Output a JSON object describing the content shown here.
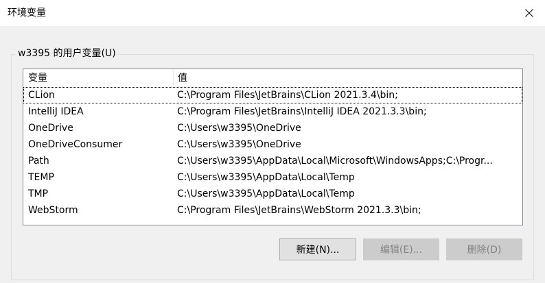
{
  "window": {
    "title": "环境变量",
    "close_icon": "close-icon"
  },
  "user_vars": {
    "group_label": "w3395 的用户变量(U)",
    "columns": [
      "变量",
      "值"
    ],
    "rows": [
      {
        "name": "CLion",
        "value": "C:\\Program Files\\JetBrains\\CLion 2021.3.4\\bin;"
      },
      {
        "name": "IntelliJ IDEA",
        "value": "C:\\Program Files\\JetBrains\\IntelliJ IDEA 2021.3.3\\bin;"
      },
      {
        "name": "OneDrive",
        "value": "C:\\Users\\w3395\\OneDrive"
      },
      {
        "name": "OneDriveConsumer",
        "value": "C:\\Users\\w3395\\OneDrive"
      },
      {
        "name": "Path",
        "value": "C:\\Users\\w3395\\AppData\\Local\\Microsoft\\WindowsApps;C:\\Progr..."
      },
      {
        "name": "TEMP",
        "value": "C:\\Users\\w3395\\AppData\\Local\\Temp"
      },
      {
        "name": "TMP",
        "value": "C:\\Users\\w3395\\AppData\\Local\\Temp"
      },
      {
        "name": "WebStorm",
        "value": "C:\\Program Files\\JetBrains\\WebStorm 2021.3.3\\bin;"
      }
    ],
    "buttons": {
      "new_label": "新建(N)...",
      "edit_label": "编辑(E)...",
      "delete_label": "删除(D)"
    }
  }
}
